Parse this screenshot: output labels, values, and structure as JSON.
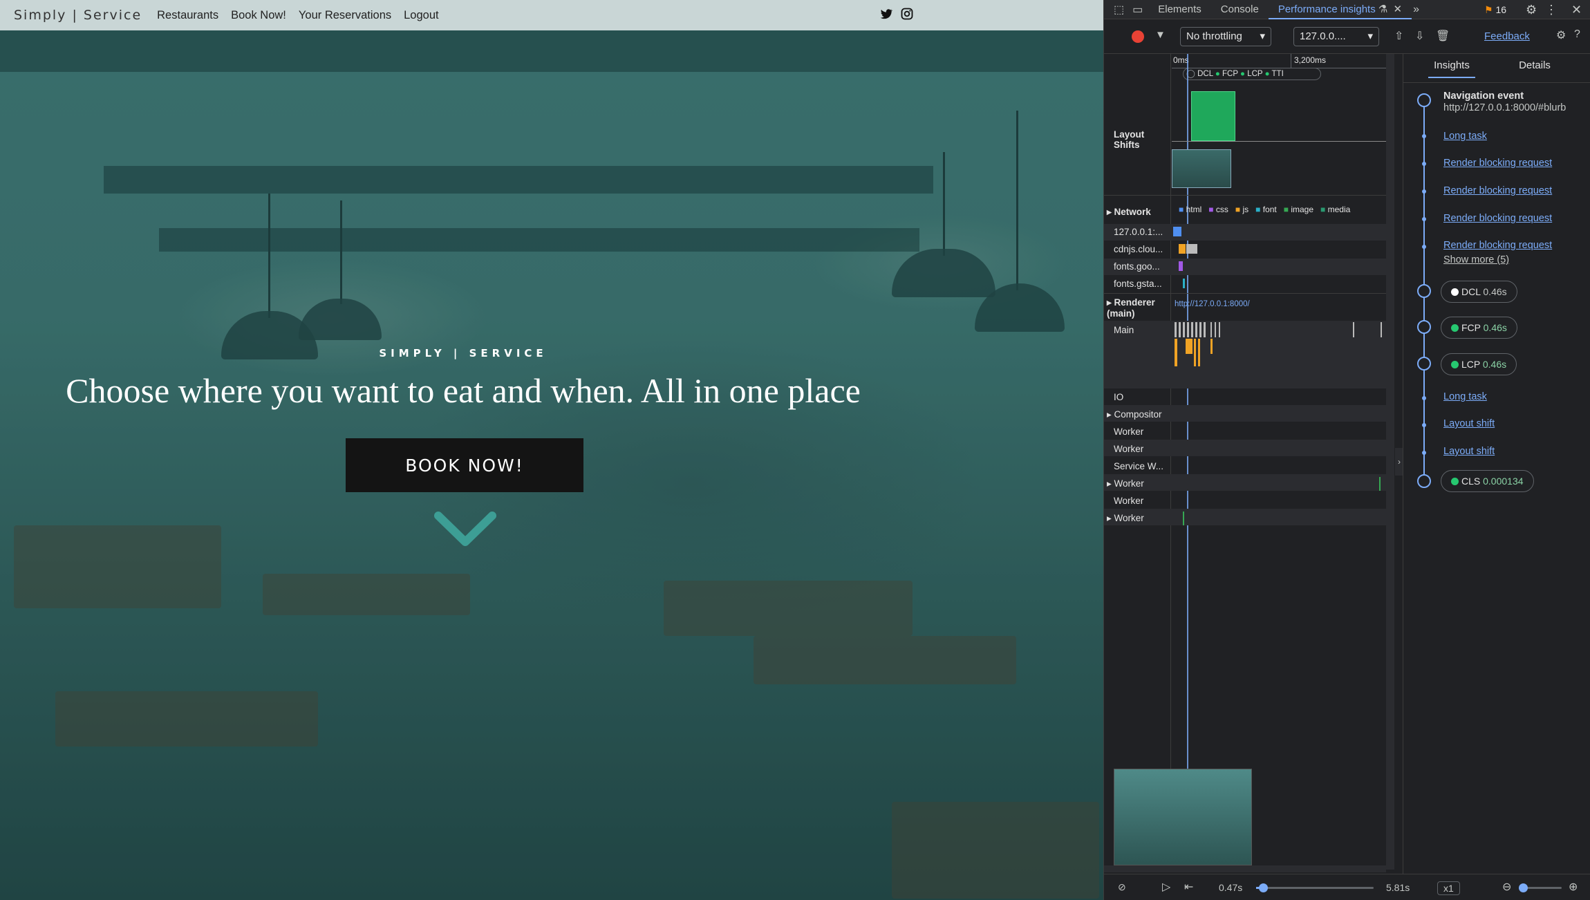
{
  "site": {
    "brand": "Simply | Service",
    "nav": [
      "Restaurants",
      "Book Now!",
      "Your Reservations",
      "Logout"
    ],
    "social_icons": [
      "twitter-icon",
      "instagram-icon"
    ],
    "kicker": "SIMPLY | SERVICE",
    "headline": "Choose where you want to eat and when. All in one place",
    "cta": "BOOK NOW!"
  },
  "devtools": {
    "tabs": [
      "Elements",
      "Console",
      "Performance insights"
    ],
    "active_tab": "Performance insights",
    "issues_count": "16",
    "throttling": "No throttling",
    "url_select": "127.0.0....",
    "feedback": "Feedback",
    "ruler": {
      "start": "0ms",
      "mid": "3,200ms"
    },
    "markers": [
      "DCL",
      "FCP",
      "LCP",
      "TTI"
    ],
    "tracks": {
      "layout_shifts": "Layout Shifts",
      "network": "Network",
      "legend": [
        "html",
        "css",
        "js",
        "font",
        "image",
        "media"
      ],
      "hosts": [
        "127.0.0.1:...",
        "cdnjs.clou...",
        "fonts.goo...",
        "fonts.gsta..."
      ],
      "renderer": "Renderer (main)",
      "renderer_url": "http://127.0.0.1:8000/",
      "main": "Main",
      "threads": [
        "IO",
        "Compositor",
        "Worker",
        "Worker",
        "Service W...",
        "Worker",
        "Worker",
        "Worker"
      ]
    },
    "side_tabs": [
      "Insights",
      "Details"
    ],
    "insights": {
      "nav_title": "Navigation event",
      "nav_url": "http://127.0.0.1:8000/#blurb",
      "links_a": [
        "Long task",
        "Render blocking request",
        "Render blocking request",
        "Render blocking request",
        "Render blocking request"
      ],
      "show_more": "Show more (5)",
      "metrics": [
        {
          "name": "DCL",
          "value": "0.46s"
        },
        {
          "name": "FCP",
          "value": "0.46s"
        },
        {
          "name": "LCP",
          "value": "0.46s"
        }
      ],
      "links_b": [
        "Long task",
        "Layout shift",
        "Layout shift"
      ],
      "cls": {
        "name": "CLS",
        "value": "0.000134"
      }
    },
    "playback": {
      "current": "0.47s",
      "end": "5.81s",
      "speed": "x1"
    }
  }
}
